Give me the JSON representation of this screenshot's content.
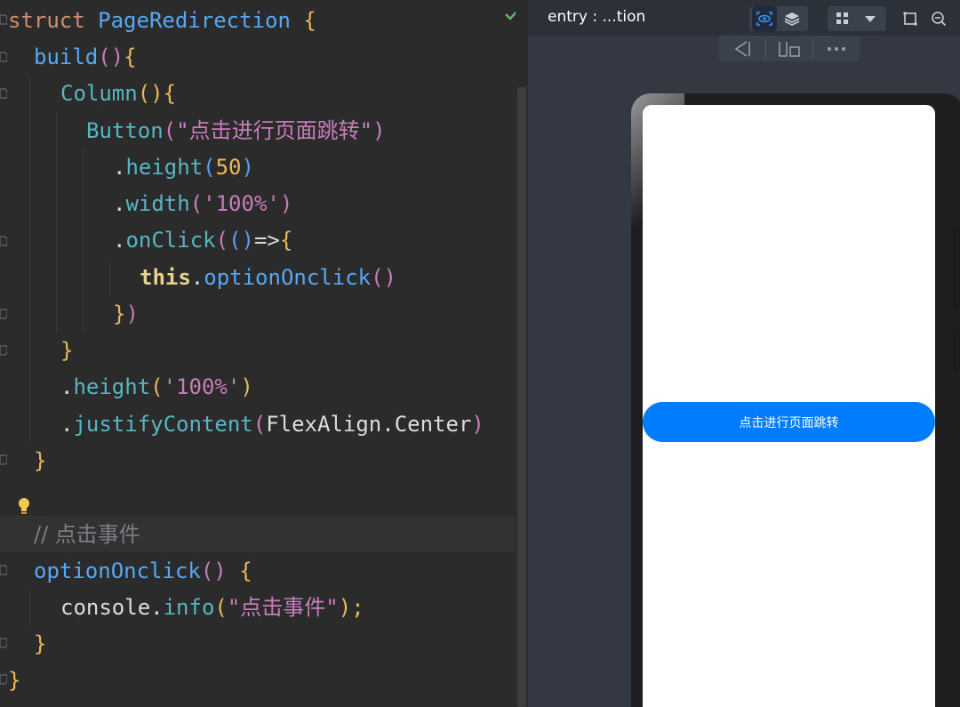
{
  "editor": {
    "lines": {
      "l1": {
        "kw": "struct",
        "name": "PageRedirection",
        "brace": "{"
      },
      "l2": {
        "fn": "build",
        "open": "()",
        "brace": "{"
      },
      "l3": {
        "fn": "Column",
        "open": "()",
        "brace": "{"
      },
      "l4": {
        "fn": "Button",
        "p_open": "(",
        "str": "\"点击进行页面跳转\"",
        "p_close": ")"
      },
      "l5": {
        "dot": ".",
        "fn": "height",
        "p_open": "(",
        "num": "50",
        "p_close": ")"
      },
      "l6": {
        "dot": ".",
        "fn": "width",
        "p_open": "(",
        "str": "'100%'",
        "p_close": ")"
      },
      "l7": {
        "dot": ".",
        "fn": "onClick",
        "p_open": "(",
        "args": "()",
        "arrow": "=>",
        "brace": "{"
      },
      "l8": {
        "this": "this",
        "dot": ".",
        "fn": "optionOnclick",
        "call": "()"
      },
      "l9": {
        "brace": "}",
        "p_close": ")"
      },
      "l10": {
        "brace": "}"
      },
      "l11": {
        "dot": ".",
        "fn": "height",
        "p_open": "(",
        "str": "'100%'",
        "p_close": ")"
      },
      "l12": {
        "dot": ".",
        "fn": "justifyContent",
        "p_open": "(",
        "arg": "FlexAlign.Center",
        "p_close": ")"
      },
      "l13": {
        "brace": "}"
      },
      "l14": {
        "comment": "// 点击事件"
      },
      "l15": {
        "fn": "optionOnclick",
        "call": "()",
        "brace": "{"
      },
      "l16": {
        "obj": "console",
        "dot": ".",
        "fn": "info",
        "p_open": "(",
        "str": "\"点击事件\"",
        "p_close": ")",
        "semi": ";"
      },
      "l17": {
        "brace": "}"
      },
      "l18": {
        "brace": "}"
      }
    }
  },
  "previewer": {
    "title": "entry : ...tion",
    "icons": {
      "inspect": "eye-icon",
      "layers": "layers-icon",
      "grid": "grid-icon",
      "dropdown": "chevron-down-icon",
      "crop": "crop-icon",
      "zoom": "zoom-out-icon",
      "back": "back-icon",
      "fold": "fold-icon",
      "more": "more-icon"
    },
    "app": {
      "button_label": "点击进行页面跳转"
    }
  }
}
